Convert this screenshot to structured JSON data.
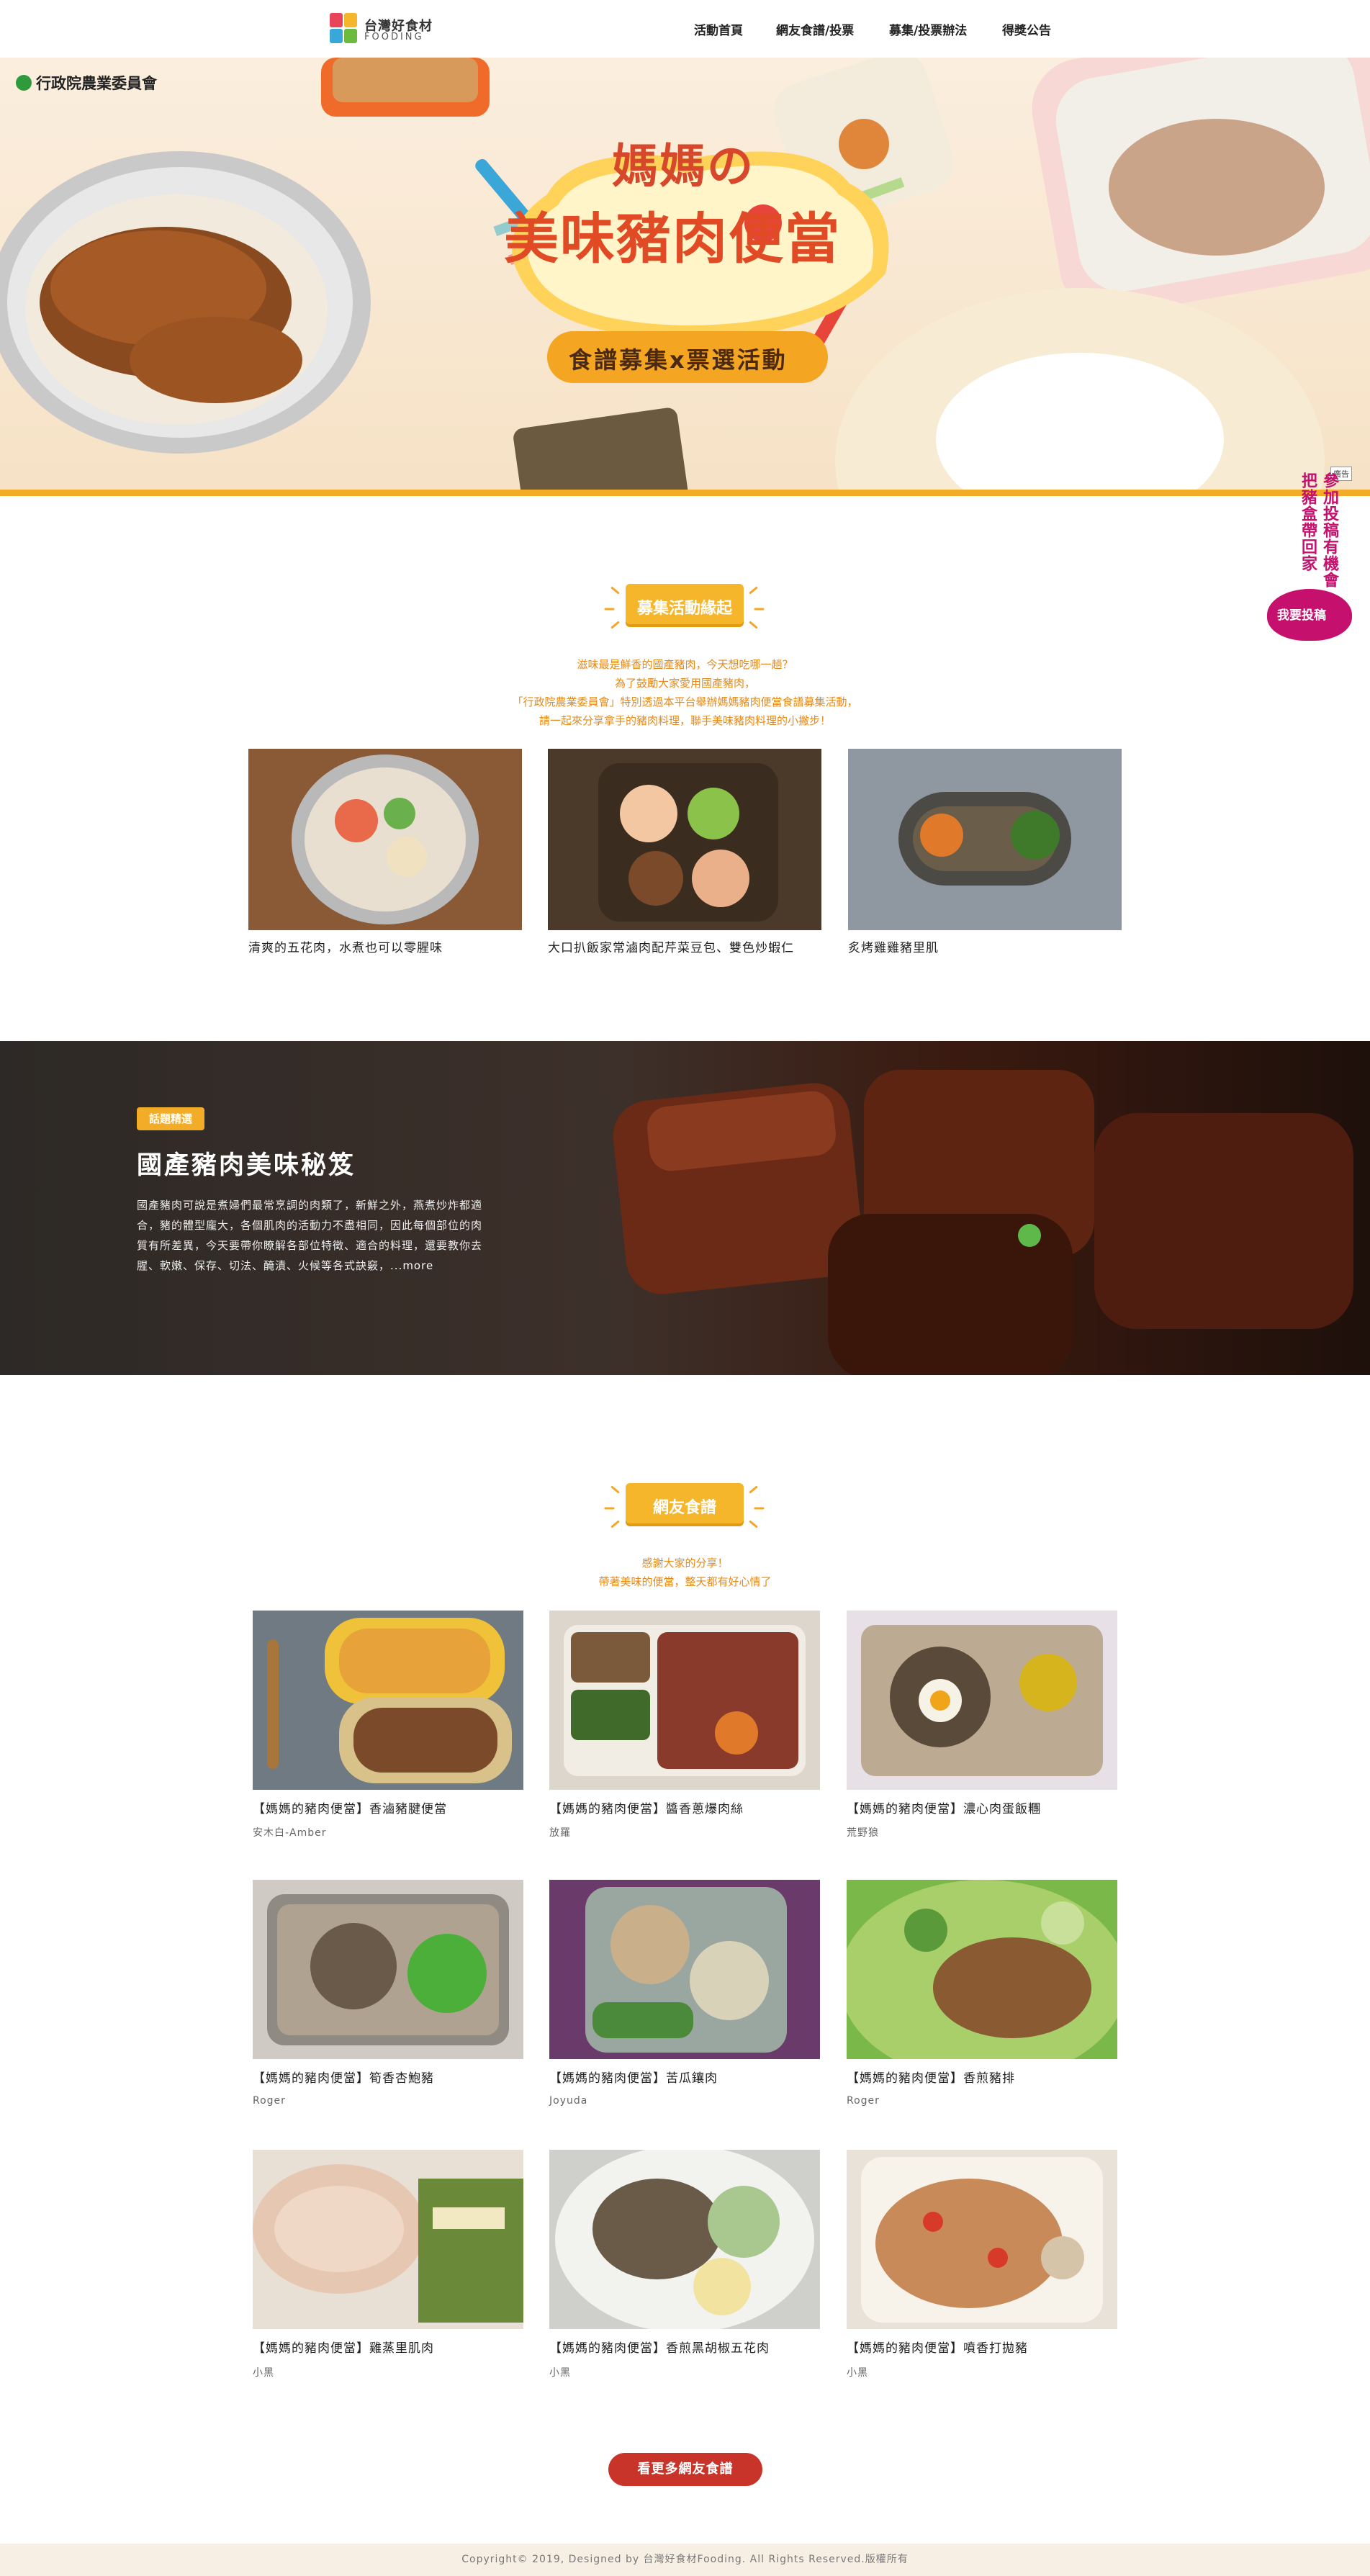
{
  "header": {
    "logo_title": "台灣好食材",
    "logo_sub": "FOODING",
    "nav": [
      {
        "label": "活動首頁"
      },
      {
        "label": "網友食譜/投票"
      },
      {
        "label": "募集/投票辦法"
      },
      {
        "label": "得獎公告"
      }
    ]
  },
  "hero": {
    "org": "行政院農業委員會",
    "title_line1": "媽媽の",
    "title_line2": "美味豬肉便當",
    "subtitle": "食譜募集x票選活動"
  },
  "side_ad": {
    "tag": "廣告",
    "line1": "參加投稿有機會",
    "line2": "把豬盒帶回家",
    "button": "我要投稿"
  },
  "section_origin": {
    "title": "募集活動緣起",
    "intro": [
      "滋味最是鮮香的國產豬肉，今天想吃哪一趟？",
      "為了鼓勵大家愛用國產豬肉，",
      "「行政院農業委員會」特別透過本平台舉辦媽媽豬肉便當食譜募集活動，",
      "請一起來分享拿手的豬肉料理，聯手美味豬肉料理的小撇步！"
    ],
    "cards": [
      {
        "caption": "清爽的五花肉，水煮也可以零腥味"
      },
      {
        "caption": "大口扒飯家常滷肉配芹菜豆包、雙色炒蝦仁"
      },
      {
        "caption": "炙烤雞雞豬里肌"
      }
    ]
  },
  "banner": {
    "tag": "話題精選",
    "title": "國產豬肉美味秘笈",
    "body": "國產豬肉可說是煮婦們最常烹調的肉類了，新鮮之外，燕煮炒炸都適合，豬的體型龐大，各個肌肉的活動力不盡相同，因此每個部位的肉質有所差異，今天要帶你瞭解各部位特徵、適合的料理，還要教你去腥、軟嫩、保存、切法、醃漬、火候等各式訣竅，",
    "more": "...more"
  },
  "section_recipes": {
    "title": "網友食譜",
    "intro": [
      "感謝大家的分享！",
      "帶著美味的便當，整天都有好心情了"
    ],
    "items": [
      {
        "title": "【媽媽的豬肉便當】香滷豬腱便當",
        "author": "安木白-Amber"
      },
      {
        "title": "【媽媽的豬肉便當】醬香蔥爆肉絲",
        "author": "放羅"
      },
      {
        "title": "【媽媽的豬肉便當】濃心肉蛋飯糰",
        "author": "荒野狼"
      },
      {
        "title": "【媽媽的豬肉便當】筍香杏鮑豬",
        "author": "Roger"
      },
      {
        "title": "【媽媽的豬肉便當】苦瓜鑲肉",
        "author": "Joyuda"
      },
      {
        "title": "【媽媽的豬肉便當】香煎豬排",
        "author": "Roger"
      },
      {
        "title": "【媽媽的豬肉便當】雞蒸里肌肉",
        "author": "小黑"
      },
      {
        "title": "【媽媽的豬肉便當】香煎黑胡椒五花肉",
        "author": "小黑"
      },
      {
        "title": "【媽媽的豬肉便當】噴香打拋豬",
        "author": "小黑"
      }
    ],
    "more_button": "看更多網友食譜"
  },
  "footer": {
    "text": "Copyright© 2019, Designed by 台灣好食材Fooding. All Rights Reserved.版權所有"
  }
}
